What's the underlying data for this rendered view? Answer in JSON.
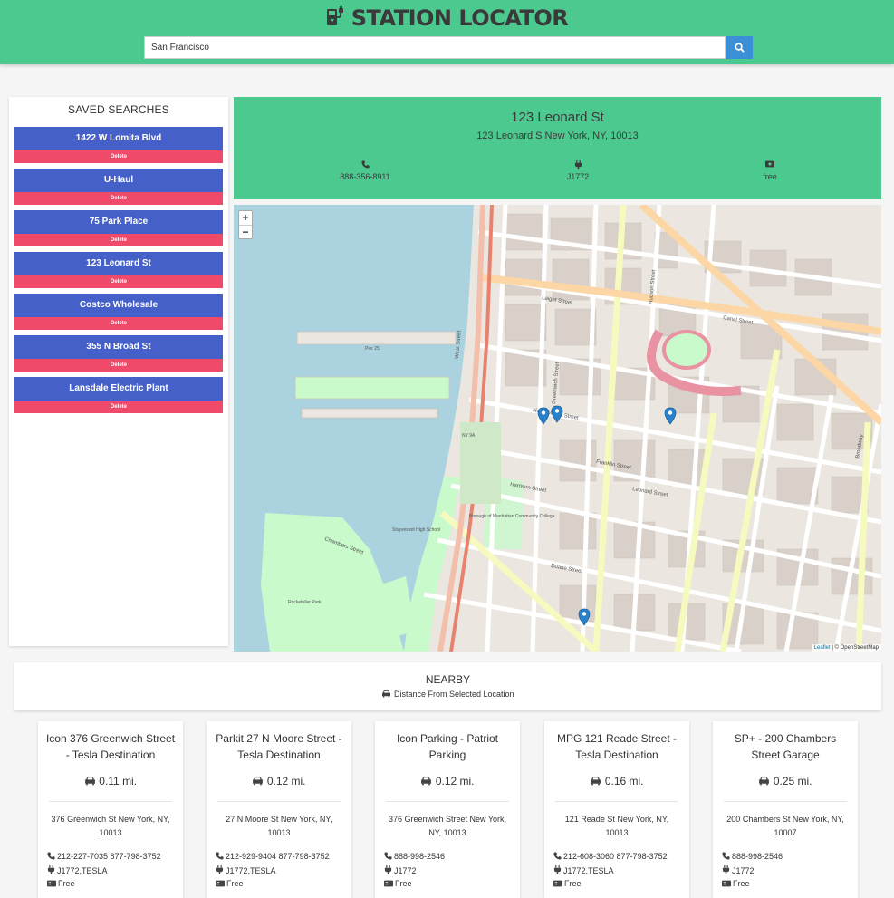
{
  "app": {
    "title": "STATION LOCATOR"
  },
  "search": {
    "value": "San Francisco",
    "button_icon": "search-icon"
  },
  "saved": {
    "title": "SAVED SEARCHES",
    "delete_label": "Delete",
    "items": [
      {
        "label": "1422 W Lomita Blvd"
      },
      {
        "label": "U-Haul"
      },
      {
        "label": "75 Park Place"
      },
      {
        "label": "123 Leonard St"
      },
      {
        "label": "Costco Wholesale"
      },
      {
        "label": "355 N Broad St"
      },
      {
        "label": "Lansdale Electric Plant"
      }
    ]
  },
  "station": {
    "name": "123 Leonard St",
    "address": "123 Leonard S New York, NY, 10013",
    "phone": "888-356-8911",
    "connector": "J1772",
    "cost": "free"
  },
  "map": {
    "zoom_in": "+",
    "zoom_out": "−",
    "attribution_leaflet": "Leaflet",
    "attribution_rest": " | © OpenStreetMap",
    "labels": {
      "west_street": "West Street",
      "north_moore": "North Moore Street",
      "leonard": "Leonard Street",
      "canal": "Canal Street",
      "hudson": "Hudson Street",
      "chambers": "Chambers Street",
      "greenwich": "Greenwich Street",
      "franklin": "Franklin Street",
      "laight": "Laight Street",
      "duane": "Duane Street",
      "harrison": "Harrison Street",
      "broadway": "Broadway",
      "bmcc": "Borough of Manhattan Community College",
      "stuyvesant": "Stuyvesant High School",
      "rockefeller": "Rockefeller Park",
      "pier25": "Pier 25",
      "ny9a": "NY 9A"
    }
  },
  "nearby": {
    "title": "NEARBY",
    "subtitle": "Distance From Selected Location",
    "cards": [
      {
        "name": "Icon 376 Greenwich Street - Tesla Destination",
        "distance": "0.11 mi.",
        "address": "376 Greenwich St New York, NY, 10013",
        "phone": "212-227-7035 877-798-3752",
        "connector": "J1772,TESLA",
        "cost": "Free"
      },
      {
        "name": "Parkit 27 N Moore Street - Tesla Destination",
        "distance": "0.12 mi.",
        "address": "27 N Moore St New York, NY, 10013",
        "phone": "212-929-9404 877-798-3752",
        "connector": "J1772,TESLA",
        "cost": "Free"
      },
      {
        "name": "Icon Parking - Patriot Parking",
        "distance": "0.12 mi.",
        "address": "376 Greenwich Street New York, NY, 10013",
        "phone": "888-998-2546",
        "connector": "J1772",
        "cost": "Free"
      },
      {
        "name": "MPG 121 Reade Street - Tesla Destination",
        "distance": "0.16 mi.",
        "address": "121 Reade St New York, NY, 10013",
        "phone": "212-608-3060 877-798-3752",
        "connector": "J1772,TESLA",
        "cost": "Free"
      },
      {
        "name": "SP+ - 200 Chambers Street Garage",
        "distance": "0.25 mi.",
        "address": "200 Chambers St New York, NY, 10007",
        "phone": "888-998-2546",
        "connector": "J1772",
        "cost": "Free"
      }
    ]
  },
  "colors": {
    "header": "#4bc98f",
    "saved_item": "#4560c8",
    "delete": "#f04a6a",
    "search_button": "#3b8fd6",
    "marker": "#2a81cb"
  }
}
